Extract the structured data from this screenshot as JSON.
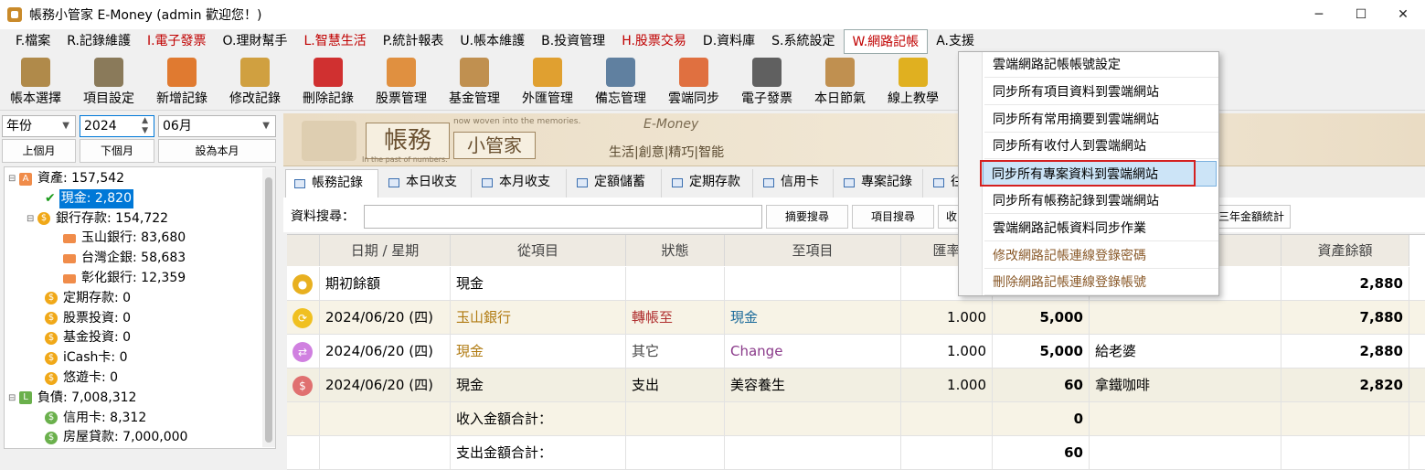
{
  "window": {
    "title": "帳務小管家 E-Money (admin 歡迎您！)",
    "minimize_label": "─",
    "maximize_label": "☐",
    "close_label": "✕"
  },
  "menu": [
    {
      "label": "F.檔案",
      "red": false
    },
    {
      "label": "R.記錄維護",
      "red": false
    },
    {
      "label": "I.電子發票",
      "red": true
    },
    {
      "label": "O.理財幫手",
      "red": false
    },
    {
      "label": "L.智慧生活",
      "red": true
    },
    {
      "label": "P.統計報表",
      "red": false
    },
    {
      "label": "U.帳本維護",
      "red": false
    },
    {
      "label": "B.投資管理",
      "red": false
    },
    {
      "label": "H.股票交易",
      "red": true
    },
    {
      "label": "D.資料庫",
      "red": false
    },
    {
      "label": "S.系統設定",
      "red": false
    },
    {
      "label": "W.網路記帳",
      "red": true
    },
    {
      "label": "A.支援",
      "red": false
    }
  ],
  "toolbar": [
    {
      "label": "帳本選擇",
      "icon": "ledger-icon",
      "color": "#b08a4a"
    },
    {
      "label": "項目設定",
      "icon": "gear-icon",
      "color": "#8a7a5a"
    },
    {
      "label": "新增記錄",
      "icon": "add-doc-icon",
      "color": "#e07a30"
    },
    {
      "label": "修改記錄",
      "icon": "edit-doc-icon",
      "color": "#d0a040"
    },
    {
      "label": "刪除記錄",
      "icon": "delete-doc-icon",
      "color": "#d03030"
    },
    {
      "label": "股票管理",
      "icon": "stock-icon",
      "color": "#e09040"
    },
    {
      "label": "基金管理",
      "icon": "fund-icon",
      "color": "#c09050"
    },
    {
      "label": "外匯管理",
      "icon": "forex-icon",
      "color": "#e0a030"
    },
    {
      "label": "備忘管理",
      "icon": "memo-icon",
      "color": "#6080a0"
    },
    {
      "label": "雲端同步",
      "icon": "cloud-sync-icon",
      "color": "#e07040"
    },
    {
      "label": "電子發票",
      "icon": "qrcode-icon",
      "color": "#606060"
    },
    {
      "label": "本日節氣",
      "icon": "solar-term-icon",
      "color": "#c09050"
    },
    {
      "label": "線上教學",
      "icon": "help-icon",
      "color": "#e0b020"
    }
  ],
  "filters": {
    "year_label": "年份",
    "year_value": "2024",
    "month_value": "06月",
    "prev_month": "上個月",
    "next_month": "下個月",
    "set_this_month": "設為本月"
  },
  "tree": [
    {
      "label": "資產: 157,542",
      "indent": 0,
      "icon": "asset-icon",
      "expand": "⊟"
    },
    {
      "label": "現金: 2,820",
      "indent": 2,
      "icon": "check-icon",
      "selected": true
    },
    {
      "label": "銀行存款: 154,722",
      "indent": 1,
      "icon": "coin-icon",
      "expand": "⊟"
    },
    {
      "label": "玉山銀行: 83,680",
      "indent": 3,
      "icon": "bank-icon"
    },
    {
      "label": "台灣企銀: 58,683",
      "indent": 3,
      "icon": "bank-icon"
    },
    {
      "label": "彰化銀行: 12,359",
      "indent": 3,
      "icon": "bank-icon"
    },
    {
      "label": "定期存款: 0",
      "indent": 2,
      "icon": "coin-icon"
    },
    {
      "label": "股票投資: 0",
      "indent": 2,
      "icon": "coin-icon"
    },
    {
      "label": "基金投資: 0",
      "indent": 2,
      "icon": "coin-icon"
    },
    {
      "label": "iCash卡: 0",
      "indent": 2,
      "icon": "coin-icon"
    },
    {
      "label": "悠遊卡: 0",
      "indent": 2,
      "icon": "coin-icon"
    },
    {
      "label": "負債: 7,008,312",
      "indent": 0,
      "icon": "liability-icon",
      "expand": "⊟"
    },
    {
      "label": "信用卡: 8,312",
      "indent": 2,
      "icon": "green-coin-icon"
    },
    {
      "label": "房屋貸款: 7,000,000",
      "indent": 2,
      "icon": "green-coin-icon"
    }
  ],
  "banner": {
    "title": "帳務",
    "subtitle": "小管家",
    "tagline_small": "now woven into the memories.",
    "tagline_past": "In the past of numbers.",
    "brand": "E-Money",
    "slogan": "生活|創意|精巧|智能"
  },
  "tabs": [
    "帳務記錄",
    "本日收支",
    "本月收支",
    "定額儲蓄",
    "定期存款",
    "信用卡",
    "專案記錄",
    "往"
  ],
  "search": {
    "label": "資料搜尋：",
    "value": "",
    "btn_summary": "摘要搜尋",
    "btn_item": "項目搜尋",
    "btn_partial": "收",
    "btn_year": "三年金額統計"
  },
  "grid": {
    "headers": [
      "日期 / 星期",
      "從項目",
      "狀態",
      "至項目",
      "匯率",
      "",
      "",
      "資產餘額"
    ],
    "rows": [
      {
        "icon": "money-bag-icon",
        "icon_color": "#e8b020",
        "date": "期初餘額",
        "from": "現金",
        "status": "",
        "to": "",
        "rate": "",
        "amount": "",
        "memo": "",
        "balance": "2,880",
        "bg": "#fff",
        "from_color": "#000",
        "to_color": "#000"
      },
      {
        "icon": "transfer-icon",
        "icon_color": "#f0c020",
        "date": "2024/06/20 (四)",
        "from": "玉山銀行",
        "status": "轉帳至",
        "to": "現金",
        "rate": "1.000",
        "amount": "5,000",
        "memo": "",
        "balance": "7,880",
        "bg": "#f7f3e6",
        "from_color": "#b07a10",
        "to_color": "#1a6a9a",
        "status_color": "#b03030"
      },
      {
        "icon": "exchange-icon",
        "icon_color": "#d080e0",
        "date": "2024/06/20 (四)",
        "from": "現金",
        "status": "其它",
        "to": "Change",
        "rate": "1.000",
        "amount": "5,000",
        "memo": "給老婆",
        "balance": "2,880",
        "bg": "#fff",
        "from_color": "#b07a10",
        "to_color": "#8a3a8a",
        "status_color": "#444"
      },
      {
        "icon": "dollar-icon",
        "icon_color": "#e07070",
        "date": "2024/06/20 (四)",
        "from": "現金",
        "status": "支出",
        "to": "美容養生",
        "rate": "1.000",
        "amount": "60",
        "memo": "拿鐵咖啡",
        "balance": "2,820",
        "bg": "#f2efe2",
        "from_color": "#000",
        "to_color": "#000",
        "status_color": "#000"
      },
      {
        "icon": "",
        "icon_color": "",
        "date": "",
        "from": "收入金額合計：",
        "status": "",
        "to": "",
        "rate": "",
        "amount": "0",
        "memo": "",
        "balance": "",
        "bg": "#f7f3e6",
        "from_color": "#000",
        "to_color": "#000"
      },
      {
        "icon": "",
        "icon_color": "",
        "date": "",
        "from": "支出金額合計：",
        "status": "",
        "to": "",
        "rate": "",
        "amount": "60",
        "memo": "",
        "balance": "",
        "bg": "#fff",
        "from_color": "#000",
        "to_color": "#000"
      }
    ]
  },
  "dropdown": [
    {
      "label": "雲端網路記帳帳號設定",
      "style": ""
    },
    {
      "label": "同步所有項目資料到雲端網站",
      "style": ""
    },
    {
      "label": "同步所有常用摘要到雲端網站",
      "style": ""
    },
    {
      "label": "同步所有收付人到雲端網站",
      "style": ""
    },
    {
      "label": "同步所有專案資料到雲端網站",
      "style": "hl"
    },
    {
      "label": "同步所有帳務記錄到雲端網站",
      "style": ""
    },
    {
      "label": "雲端網路記帳資料同步作業",
      "style": ""
    },
    {
      "label": "修改網路記帳連線登錄密碼",
      "style": "brown"
    },
    {
      "label": "刪除網路記帳連線登錄帳號",
      "style": "brown"
    }
  ]
}
